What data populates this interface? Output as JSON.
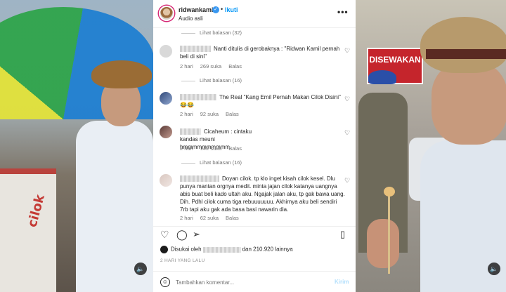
{
  "post": {
    "username": "ridwankamil",
    "follow_label": "Ikuti",
    "audio": "Audio asli"
  },
  "comments": [
    {
      "replies": "Lihat balasan (32)"
    },
    {
      "text": "Nanti ditulis di gerobaknya : \"Ridwan Kamil pernah beli di sini\"",
      "time": "2 hari",
      "likes": "269 suka",
      "reply": "Balas",
      "replies": "Lihat balasan (16)"
    },
    {
      "text": "The Real \"Kang Emil Pernah Makan Cilok Disini\" 😂😂",
      "time": "2 hari",
      "likes": "92 suka",
      "reply": "Balas"
    },
    {
      "text": "Cicaheum : cintaku kandas meuni hmmmmmmmmmm",
      "time": "2 hari",
      "likes": "142 suka",
      "reply": "Balas",
      "replies": "Lihat balasan (16)"
    },
    {
      "text": "Doyan cilok. tp klo inget kisah cilok kesel. Dlu punya mantan orgnya medit. minta jajan cilok katanya uangnya abis buat beli kado ultah aku. Ngajak jalan aku, tp gak bawa uang. Dih. Pdhl cilok cuma tiga rebuuuuuuu. Akhirnya aku beli sendiri 7rb tapi aku gak ada basa basi nawarin dia.",
      "time": "2 hari",
      "likes": "62 suka",
      "reply": "Balas"
    }
  ],
  "likes": {
    "prefix": "Disukai oleh",
    "suffix": "dan 210.920 lainnya"
  },
  "timestamp": "2 HARI YANG LALU",
  "composer": {
    "placeholder": "Tambahkan komentar...",
    "send": "Kirim"
  },
  "background": {
    "sign_text": "DISEWAKAN"
  },
  "icons": {
    "heart": "heart-icon",
    "comment": "comment-icon",
    "share": "share-icon",
    "save": "bookmark-icon",
    "emoji": "emoji-icon",
    "more": "more-options-icon",
    "mute": "mute-icon"
  },
  "colors": {
    "link": "#0095f6",
    "verified": "#3897f0",
    "text": "#262626",
    "muted": "#737373"
  }
}
